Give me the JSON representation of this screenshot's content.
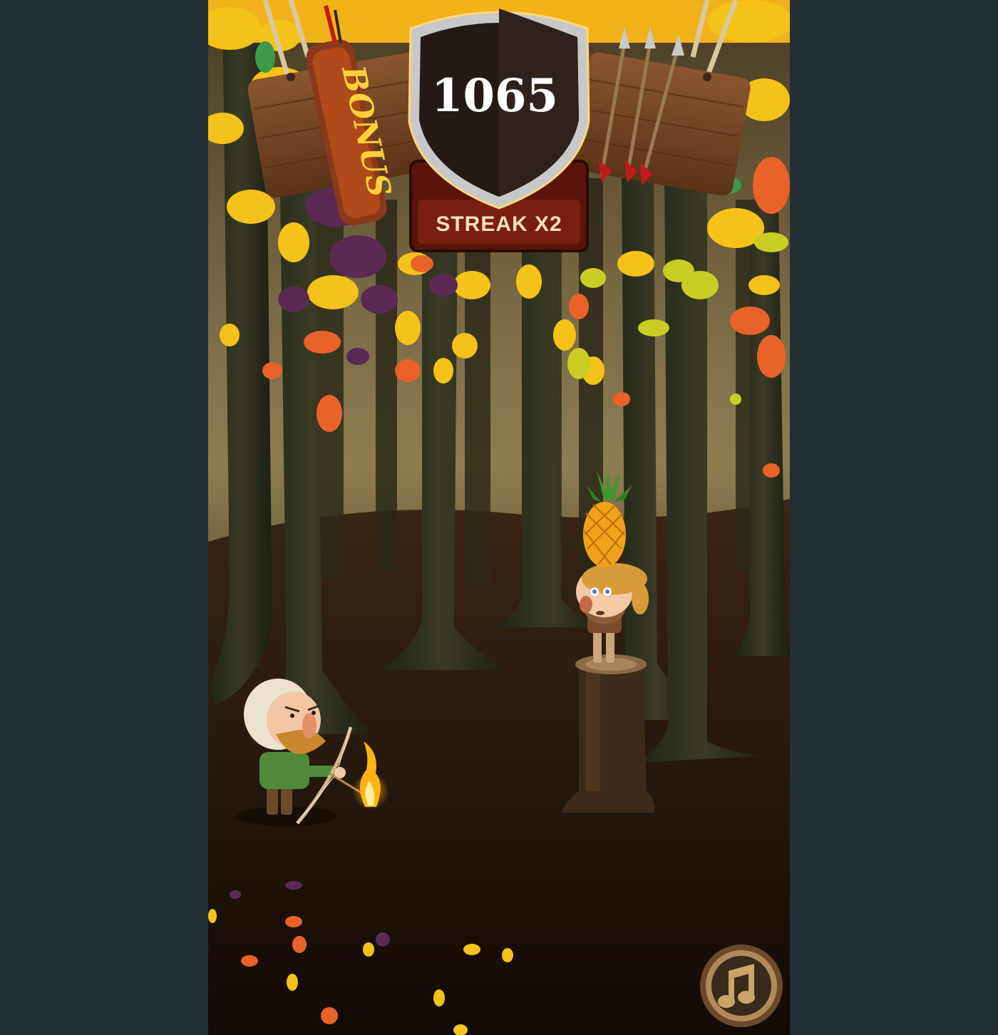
{
  "hud": {
    "score": "1065",
    "streak": "STREAK X2",
    "bonus": "BONUS"
  },
  "icons": {
    "music": "music-note-icon",
    "quiver": "quiver-icon",
    "arrows": "arrows-remaining-icon"
  },
  "game": {
    "target_fruit": "pineapple",
    "arrows_remaining": 3,
    "bonus_letters": [
      "B",
      "O",
      "N",
      "U",
      "S"
    ]
  },
  "colors": {
    "background": "#232e35",
    "leaf_yellow": "#f5c21a",
    "leaf_orange": "#e9622a",
    "leaf_purple": "#5a2a55",
    "wood": "#7a4a2a",
    "shield": "#241a15"
  }
}
